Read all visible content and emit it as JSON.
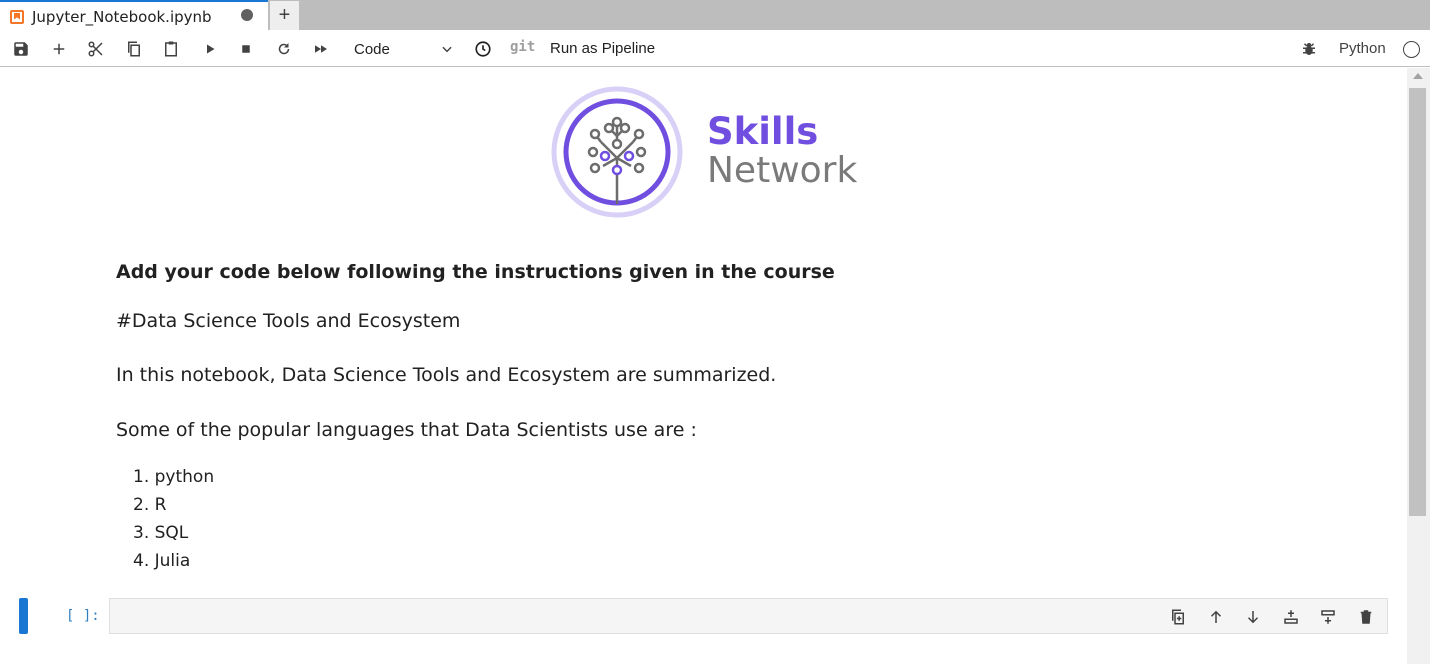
{
  "tab": {
    "title": "Jupyter_Notebook.ipynb",
    "add_label": "+"
  },
  "toolbar": {
    "cell_type": "Code",
    "git_label": "git",
    "pipeline_label": "Run as Pipeline",
    "kernel_name": "Python"
  },
  "logo": {
    "line1": "Skills",
    "line2": "Network"
  },
  "markdown": {
    "heading": "Add your code below following the instructions given in the course",
    "p1": "#Data Science Tools and Ecosystem",
    "p2": "In this notebook, Data Science Tools and Ecosystem are summarized.",
    "p3": "Some of the popular languages that Data Scientists use are :",
    "languages": [
      "1. python",
      "2. R",
      "3. SQL",
      "4. Julia"
    ]
  },
  "code_cell": {
    "prompt": "[ ]:"
  },
  "colors": {
    "accent": "#1976d2",
    "brand_purple": "#6f4ee0",
    "jupyter_orange": "#f37726"
  }
}
